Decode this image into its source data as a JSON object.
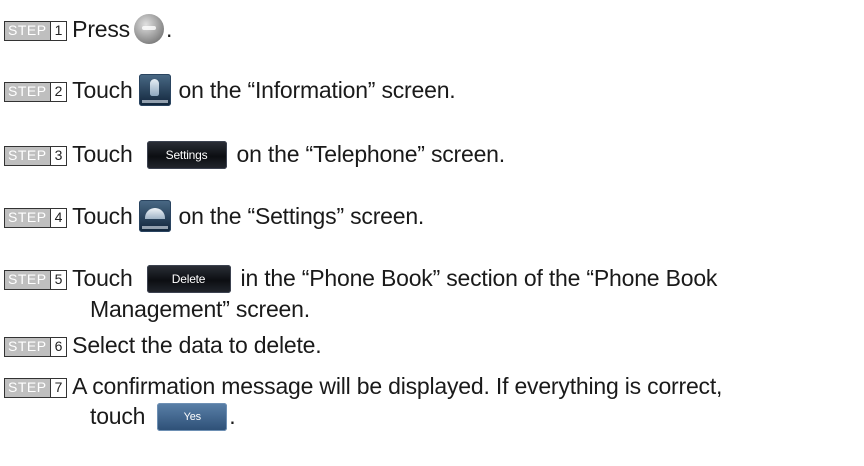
{
  "badge_label": "STEP",
  "steps": [
    {
      "number": "1",
      "before": "Press",
      "after": "."
    },
    {
      "number": "2",
      "before": "Touch",
      "after": "on the “Information” screen."
    },
    {
      "number": "3",
      "before": "Touch",
      "button": "Settings",
      "after": "on the “Telephone” screen."
    },
    {
      "number": "4",
      "before": "Touch",
      "after": "on the “Settings” screen."
    },
    {
      "number": "5",
      "before": "Touch",
      "button": "Delete",
      "after": "in the “Phone Book” section of the “Phone Book",
      "line2": "Management” screen."
    },
    {
      "number": "6",
      "text": "Select the data to delete."
    },
    {
      "number": "7",
      "text": "A confirmation message will be displayed. If everything is correct,",
      "line2_before": "touch",
      "button": "Yes",
      "line2_after": "."
    }
  ],
  "icons": {
    "step1": "info-button-icon",
    "step2": "telephone-icon",
    "step4": "phone-book-icon"
  }
}
